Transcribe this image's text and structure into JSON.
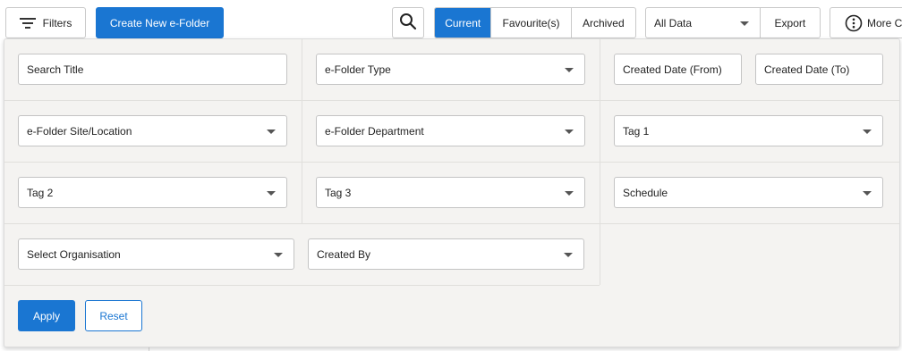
{
  "toolbar": {
    "filters_label": "Filters",
    "create_label": "Create New e-Folder",
    "tabs": [
      "Current",
      "Favourite(s)",
      "Archived"
    ],
    "data_select": "All Data",
    "export_label": "Export",
    "more_label": "More C"
  },
  "filters": {
    "search_title": "Search Title",
    "folder_type": "e-Folder Type",
    "created_from": "Created Date (From)",
    "created_to": "Created Date (To)",
    "site_location": "e-Folder Site/Location",
    "department": "e-Folder Department",
    "tag1": "Tag 1",
    "tag2": "Tag 2",
    "tag3": "Tag 3",
    "schedule": "Schedule",
    "organisation": "Select Organisation",
    "created_by": "Created By"
  },
  "actions": {
    "apply": "Apply",
    "reset": "Reset"
  },
  "colors": {
    "accent": "#1a76d2",
    "panel_bg": "#f4f3f1"
  }
}
